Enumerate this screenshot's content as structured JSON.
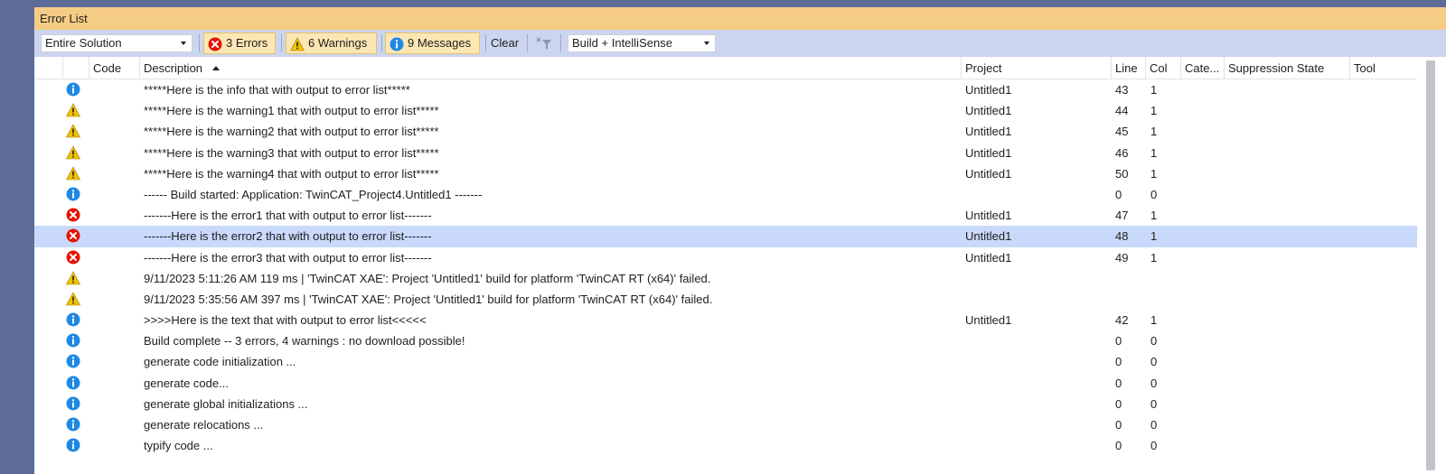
{
  "panel": {
    "title": "Error List"
  },
  "toolbar": {
    "scope": "Entire Solution",
    "errors_label": "3 Errors",
    "warnings_label": "6 Warnings",
    "messages_label": "9 Messages",
    "clear_label": "Clear",
    "source": "Build + IntelliSense"
  },
  "columns": {
    "code": "Code",
    "description": "Description",
    "project": "Project",
    "line": "Line",
    "col": "Col",
    "category": "Cate...",
    "suppression": "Suppression State",
    "tool": "Tool"
  },
  "rows": [
    {
      "type": "info",
      "description": "*****Here is the info that with output to error list*****",
      "project": "Untitled1",
      "line": "43",
      "col": "1"
    },
    {
      "type": "warning",
      "description": "*****Here is the warning1 that with output to error list*****",
      "project": "Untitled1",
      "line": "44",
      "col": "1"
    },
    {
      "type": "warning",
      "description": "*****Here is the warning2 that with output to error list*****",
      "project": "Untitled1",
      "line": "45",
      "col": "1"
    },
    {
      "type": "warning",
      "description": "*****Here is the warning3 that with output to error list*****",
      "project": "Untitled1",
      "line": "46",
      "col": "1"
    },
    {
      "type": "warning",
      "description": "*****Here is the warning4 that with output to error list*****",
      "project": "Untitled1",
      "line": "50",
      "col": "1"
    },
    {
      "type": "info",
      "description": "------ Build started: Application: TwinCAT_Project4.Untitled1 -------",
      "project": "",
      "line": "0",
      "col": "0"
    },
    {
      "type": "error",
      "description": "-------Here is the error1 that with output to error list-------",
      "project": "Untitled1",
      "line": "47",
      "col": "1"
    },
    {
      "type": "error",
      "description": "-------Here is the error2 that with output to error list-------",
      "project": "Untitled1",
      "line": "48",
      "col": "1",
      "selected": true
    },
    {
      "type": "error",
      "description": "-------Here is the error3 that with output to error list-------",
      "project": "Untitled1",
      "line": "49",
      "col": "1"
    },
    {
      "type": "warning",
      "description": "9/11/2023 5:11:26 AM 119 ms | 'TwinCAT XAE': Project 'Untitled1' build for platform 'TwinCAT RT (x64)' failed.",
      "project": "",
      "line": "",
      "col": ""
    },
    {
      "type": "warning",
      "description": "9/11/2023 5:35:56 AM 397 ms | 'TwinCAT XAE': Project 'Untitled1' build for platform 'TwinCAT RT (x64)' failed.",
      "project": "",
      "line": "",
      "col": ""
    },
    {
      "type": "info",
      "description": ">>>>Here is the text that with output to error list<<<<<",
      "project": "Untitled1",
      "line": "42",
      "col": "1"
    },
    {
      "type": "info",
      "description": "Build complete -- 3 errors, 4 warnings : no download possible!",
      "project": "",
      "line": "0",
      "col": "0"
    },
    {
      "type": "info",
      "description": "generate code initialization ...",
      "project": "",
      "line": "0",
      "col": "0"
    },
    {
      "type": "info",
      "description": "generate code...",
      "project": "",
      "line": "0",
      "col": "0"
    },
    {
      "type": "info",
      "description": "generate global initializations ...",
      "project": "",
      "line": "0",
      "col": "0"
    },
    {
      "type": "info",
      "description": "generate relocations ...",
      "project": "",
      "line": "0",
      "col": "0"
    },
    {
      "type": "info",
      "description": "typify code ...",
      "project": "",
      "line": "0",
      "col": "0"
    }
  ],
  "colors": {
    "title_bar": "#f5cc84",
    "toolbar": "#ccd5f0",
    "selected_row": "#c9d9fc",
    "error": "#e51400",
    "warning": "#f2c200",
    "info": "#1e88e5"
  }
}
